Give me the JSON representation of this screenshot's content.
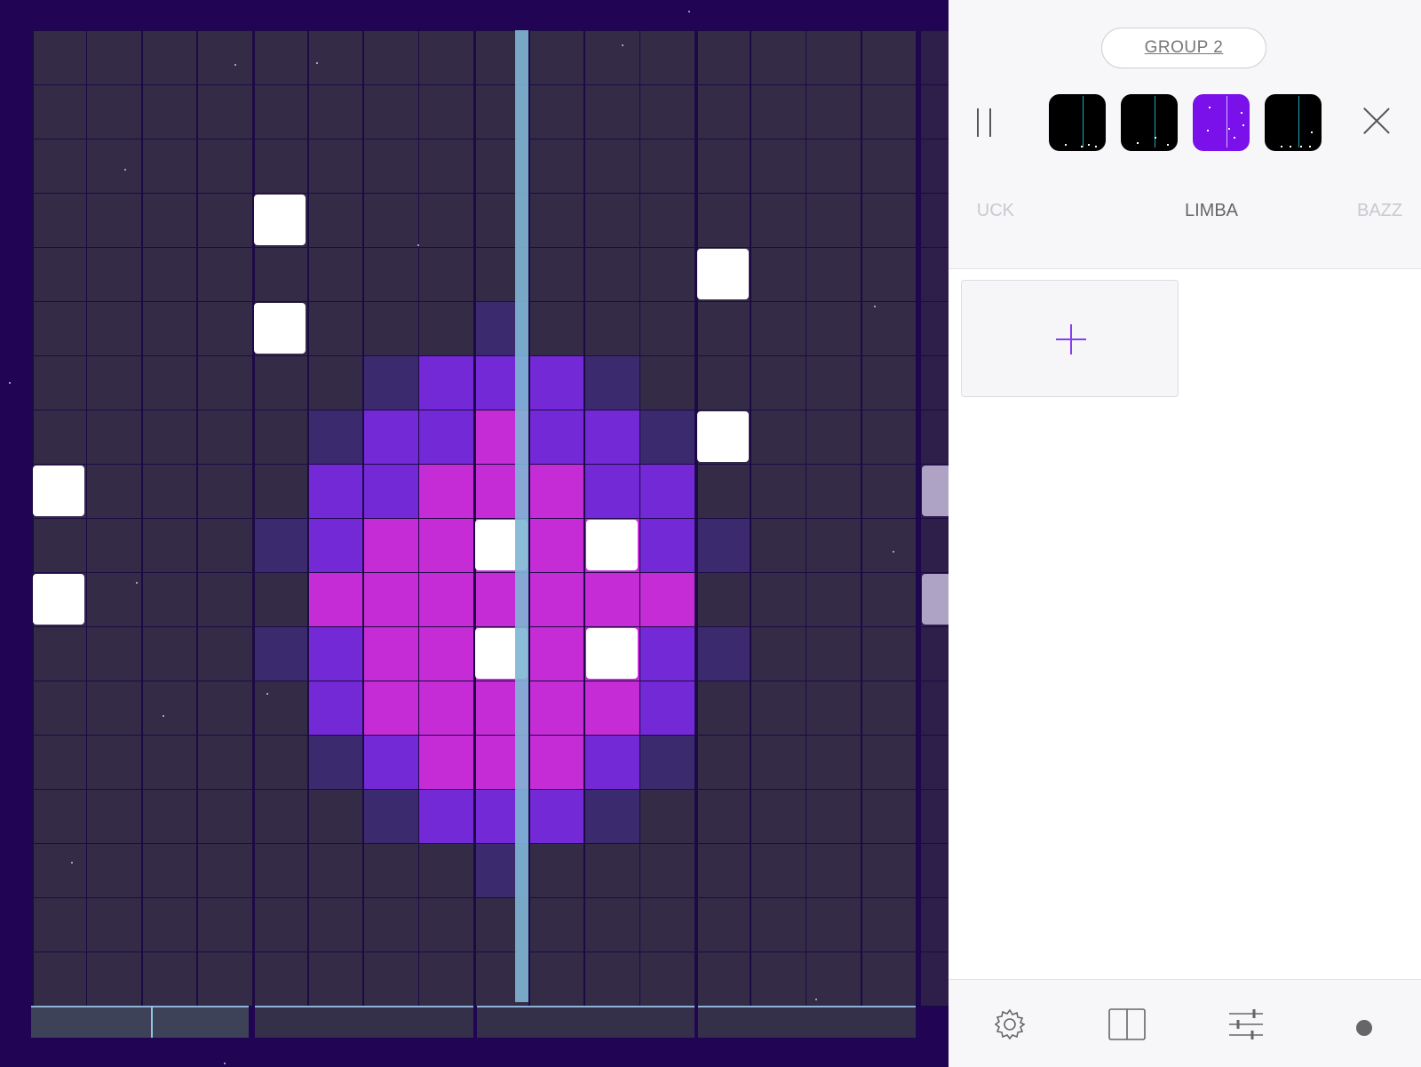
{
  "sequencer": {
    "columns": 16,
    "rows": 18,
    "playhead_column": 8,
    "active_notes": [
      {
        "col": 4,
        "row": 3
      },
      {
        "col": 4,
        "row": 5
      },
      {
        "col": 12,
        "row": 4
      },
      {
        "col": 12,
        "row": 7
      },
      {
        "col": 0,
        "row": 8
      },
      {
        "col": 0,
        "row": 10
      },
      {
        "col": 8,
        "row": 9
      },
      {
        "col": 10,
        "row": 9
      },
      {
        "col": 8,
        "row": 11
      },
      {
        "col": 10,
        "row": 11
      }
    ],
    "offscreen_notes": [
      8,
      10
    ],
    "timeline": {
      "segments": 4,
      "active_segment": 0,
      "progress": 0.55
    },
    "colors": {
      "cell": "#342b47",
      "grid_line": "#1c0a45",
      "background": "#210554",
      "note": "#ffffff",
      "playhead": "#7fb6d4",
      "glow_low": "#3b2a6e",
      "glow_mid": "#7329d6",
      "glow_high": "#c62cd6"
    }
  },
  "panel": {
    "group_label": "GROUP 2",
    "pause_icon": "pause-icon",
    "patterns": [
      {
        "selected": false
      },
      {
        "selected": false
      },
      {
        "selected": true
      },
      {
        "selected": false
      }
    ],
    "close_icon": "close-icon",
    "instruments": {
      "prev": "UCK",
      "current": "LIMBA",
      "next": "BAZZ"
    },
    "add_slot_icon": "plus-icon",
    "toolbar": [
      {
        "name": "settings-button",
        "icon": "gear-icon"
      },
      {
        "name": "library-button",
        "icon": "book-icon"
      },
      {
        "name": "mixer-button",
        "icon": "sliders-icon"
      },
      {
        "name": "record-button",
        "icon": "record-icon"
      }
    ],
    "accent": "#7a10ea"
  }
}
